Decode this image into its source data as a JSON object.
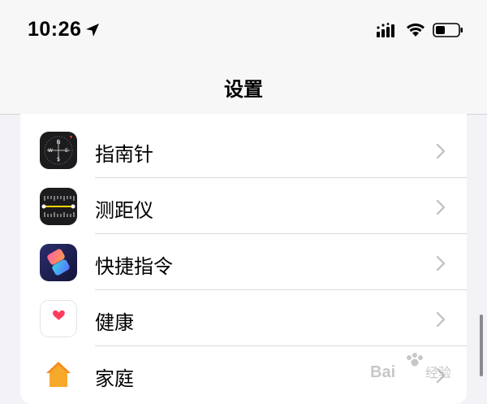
{
  "status_bar": {
    "time": "10:26",
    "icons": [
      "location-arrow-icon",
      "cellular-signal-icon",
      "wifi-icon",
      "battery-icon"
    ]
  },
  "nav": {
    "title": "设置"
  },
  "settings_rows": [
    {
      "label": "指南针",
      "icon": "compass-icon"
    },
    {
      "label": "测距仪",
      "icon": "measure-icon"
    },
    {
      "label": "快捷指令",
      "icon": "shortcuts-icon"
    },
    {
      "label": "健康",
      "icon": "health-icon"
    },
    {
      "label": "家庭",
      "icon": "home-icon"
    }
  ],
  "watermark": {
    "text": "Baidu 经验"
  },
  "colors": {
    "background": "#f2f2f7",
    "nav_background": "#f7f7f7",
    "chevron": "#c4c4c7",
    "health_heart": "#ff3b5c",
    "home_orange": "#f7a92b"
  }
}
